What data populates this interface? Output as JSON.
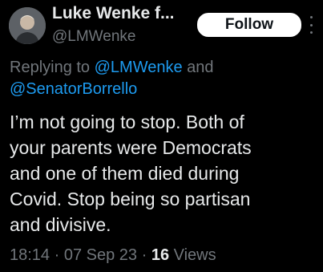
{
  "header": {
    "display_name": "Luke Wenke f...",
    "handle": "@LMWenke",
    "follow_label": "Follow"
  },
  "reply": {
    "prefix": "Replying to ",
    "mention_1": "@LMWenke",
    "joiner": " and",
    "mention_2": "@SenatorBorrello"
  },
  "tweet": {
    "text": "I’m not going to stop.  Both of\nyour parents were Democrats\nand one of them died during\nCovid.  Stop being so partisan\nand divisive."
  },
  "meta": {
    "time": "18:14",
    "separator_1": " · ",
    "date": "07 Sep 23",
    "separator_2": " · ",
    "views_count": "16",
    "views_label": " Views"
  },
  "colors": {
    "background": "#000000",
    "text": "#e7e9ea",
    "secondary": "#71767b",
    "link": "#1d9bf0"
  }
}
